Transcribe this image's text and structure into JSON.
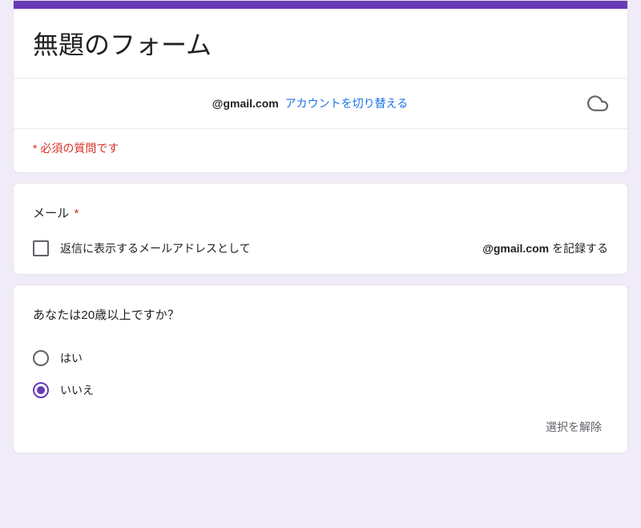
{
  "form": {
    "title": "無題のフォーム",
    "account": {
      "domain": "@gmail.com",
      "switch_label": "アカウントを切り替える"
    },
    "required_notice": "* 必須の質問です"
  },
  "q_email": {
    "label": "メール",
    "asterisk": "*",
    "checkbox_text_left": "返信に表示するメールアドレスとして",
    "checkbox_text_domain": "@gmail.com",
    "checkbox_text_right": " を記録する"
  },
  "q_age": {
    "label": "あなたは20歳以上ですか？",
    "options": {
      "yes": "はい",
      "no": "いいえ"
    },
    "clear_label": "選択を解除"
  }
}
